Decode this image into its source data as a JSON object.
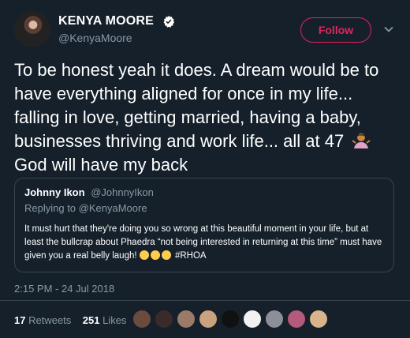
{
  "author": {
    "name": "KENYA MOORE",
    "handle": "@KenyaMoore",
    "verified": true
  },
  "follow_label": "Follow",
  "tweet": {
    "text_part1": "To be honest yeah it does. A dream would be to have everything aligned for once in my life... falling in love, getting married, having a baby, businesses thriving and work life... all at 47",
    "emoji": "person-shrugging-emoji",
    "text_part2": "God will have my back"
  },
  "quote": {
    "author_name": "Johnny Ikon",
    "author_handle": "@JohnnyIkon",
    "replying_to": "Replying to @KenyaMoore",
    "text": "It must hurt that they're doing you so wrong at this beautiful moment in your life, but at least the bullcrap about Phaedra “not being interested in returning at this time” must have given you a real belly laugh!",
    "hashtag": "#RHOA"
  },
  "timestamp": "2:15 PM - 24 Jul 2018",
  "stats": {
    "retweets_count": "17",
    "retweets_label": "Retweets",
    "likes_count": "251",
    "likes_label": "Likes"
  },
  "likers": [
    {
      "color": "#6b4b3e"
    },
    {
      "color": "#3b2a2a"
    },
    {
      "color": "#9a7b6a"
    },
    {
      "color": "#c9a27e"
    },
    {
      "color": "#111111"
    },
    {
      "color": "#f2f2f2"
    },
    {
      "color": "#8a8f98"
    },
    {
      "color": "#b45a7a"
    },
    {
      "color": "#d9b38c"
    }
  ],
  "colors": {
    "background": "#15202b",
    "follow": "#e0245e",
    "secondary_text": "#8899a6",
    "border": "#38444d"
  }
}
